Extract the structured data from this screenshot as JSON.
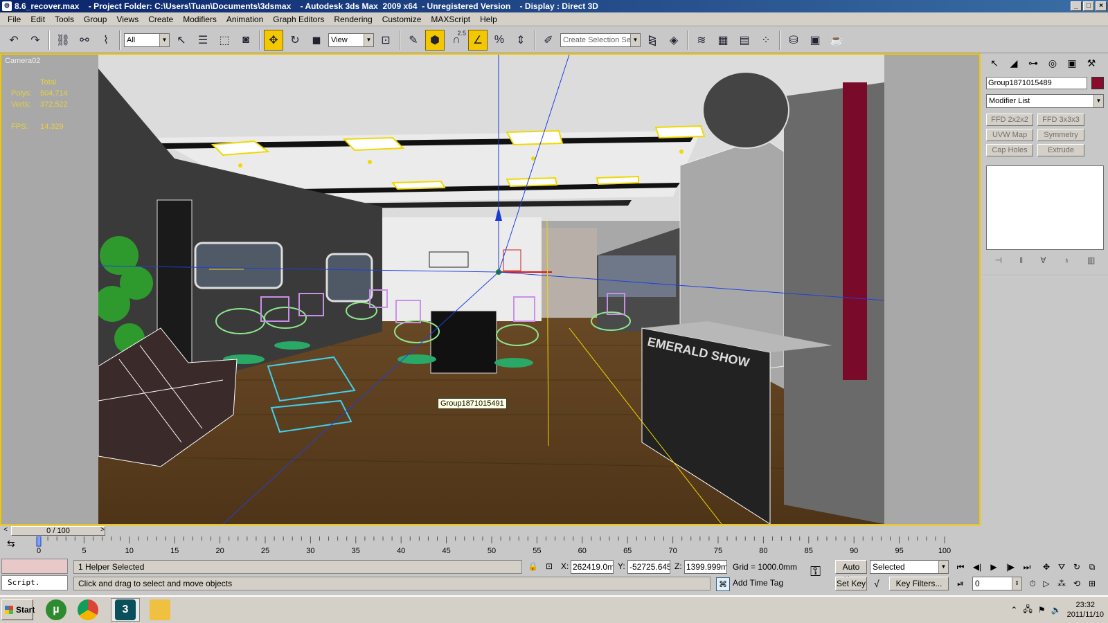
{
  "window": {
    "title": "8.6_recover.max    - Project Folder: C:\\Users\\Tuan\\Documents\\3dsmax    - Autodesk 3ds Max  2009 x64  - Unregistered Version    - Display : Direct 3D",
    "buttons": [
      "_",
      "□",
      "×"
    ]
  },
  "menu": [
    "File",
    "Edit",
    "Tools",
    "Group",
    "Views",
    "Create",
    "Modifiers",
    "Animation",
    "Graph Editors",
    "Rendering",
    "Customize",
    "MAXScript",
    "Help"
  ],
  "toolbar": {
    "selection_filter": "All",
    "reference_coord": "View",
    "selection_set_placeholder": "Create Selection Set",
    "snap_label": "2.5"
  },
  "viewport": {
    "label": "Camera02",
    "stats_header": "Total",
    "polys_label": "Polys:",
    "polys": "504,714",
    "verts_label": "Verts:",
    "verts": "372,522",
    "fps_label": "FPS:",
    "fps": "14.329",
    "tooltip": "Group1871015491",
    "sign_text": "EMERALD SHOW"
  },
  "command_panel": {
    "object_name": "Group1871015489",
    "object_color": "#8a0c2c",
    "modifier_list": "Modifier List",
    "modifier_buttons": [
      "FFD 2x2x2",
      "FFD 3x3x3",
      "UVW Map",
      "Symmetry",
      "Cap Holes",
      "Extrude"
    ]
  },
  "time_slider": {
    "position": "0 / 100",
    "left_arrow": "<",
    "right_arrow": ">",
    "ticks": [
      "0",
      "5",
      "10",
      "15",
      "20",
      "25",
      "30",
      "35",
      "40",
      "45",
      "50",
      "55",
      "60",
      "65",
      "70",
      "75",
      "80",
      "85",
      "90",
      "95",
      "100"
    ]
  },
  "status": {
    "script_label": "Script.",
    "selection": "1 Helper Selected",
    "prompt": "Click and drag to select and move objects",
    "x_label": "X:",
    "x": "262419.0m",
    "y_label": "Y:",
    "y": "-52725.645",
    "z_label": "Z:",
    "z": "1399.999m",
    "grid": "Grid = 1000.0mm",
    "add_time_tag": "Add Time Tag",
    "auto_key": "Auto Key",
    "set_key": "Set Key",
    "key_mode": "Selected",
    "key_filters": "Key Filters...",
    "frame": "0"
  },
  "taskbar": {
    "start": "Start",
    "time": "23:32",
    "date": "2011/11/10"
  }
}
